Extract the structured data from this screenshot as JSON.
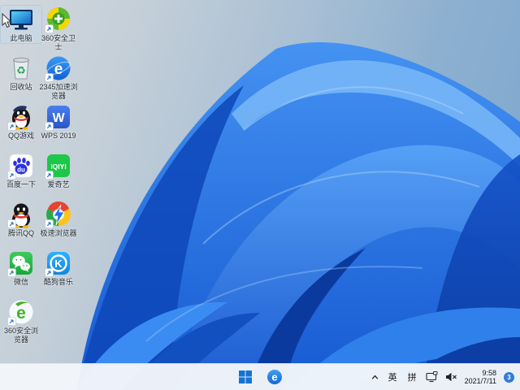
{
  "wallpaper": {
    "bg_left": "#d2d8dd",
    "bg_right": "#7ba6cd",
    "bloom_primary": "#2b7ae4",
    "bloom_dark": "#0c3fa6",
    "bloom_light": "#7ab8f8"
  },
  "desktop": {
    "icons": [
      {
        "name": "this-pc",
        "label": "此电脑",
        "shortcut": false,
        "selected": true
      },
      {
        "name": "360-safe",
        "label": "360安全卫士",
        "shortcut": true,
        "selected": false
      },
      {
        "name": "recycle-bin",
        "label": "回收站",
        "shortcut": false,
        "selected": false
      },
      {
        "name": "2345-browser",
        "label": "2345加速浏览器",
        "shortcut": true,
        "selected": false
      },
      {
        "name": "qq-games",
        "label": "QQ游戏",
        "shortcut": true,
        "selected": false
      },
      {
        "name": "wps-2019",
        "label": "WPS 2019",
        "shortcut": true,
        "selected": false
      },
      {
        "name": "baidu",
        "label": "百度一下",
        "shortcut": true,
        "selected": false
      },
      {
        "name": "iqiyi",
        "label": "爱奇艺",
        "shortcut": true,
        "selected": false
      },
      {
        "name": "tencent-qq",
        "label": "腾讯QQ",
        "shortcut": true,
        "selected": false
      },
      {
        "name": "speed-browser",
        "label": "极速浏览器",
        "shortcut": true,
        "selected": false
      },
      {
        "name": "wechat",
        "label": "微信",
        "shortcut": true,
        "selected": false
      },
      {
        "name": "kugou-music",
        "label": "酷狗音乐",
        "shortcut": true,
        "selected": false
      },
      {
        "name": "360-browser",
        "label": "360安全浏览器",
        "shortcut": true,
        "selected": false
      }
    ]
  },
  "taskbar": {
    "bg_color": "#f3f6fa",
    "accent_blue": "#1573d2",
    "tray": {
      "ime_english": "英",
      "ime_pinyin": "拼"
    },
    "clock": {
      "time": "9:58",
      "date": "2021/7/11"
    },
    "badge": {
      "count": "3",
      "color": "#2e7cd6"
    }
  }
}
